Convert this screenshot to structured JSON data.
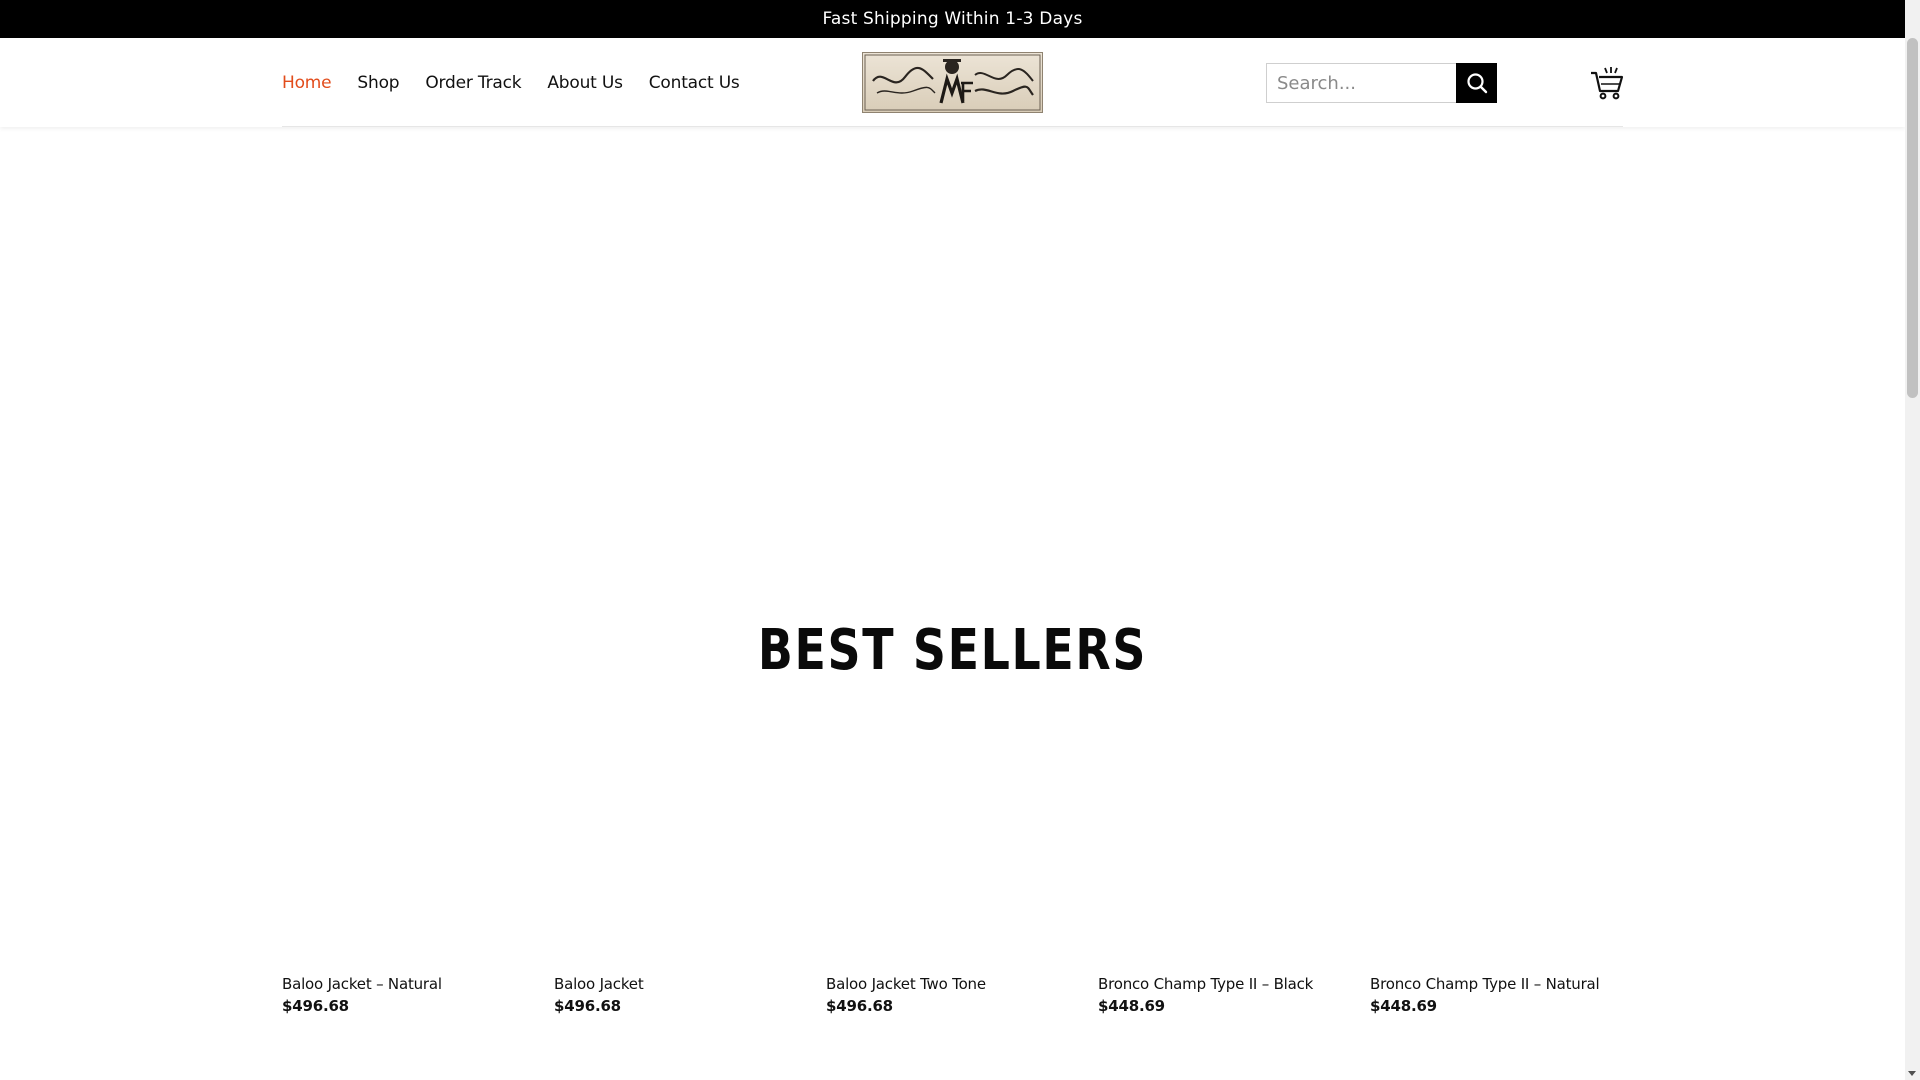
{
  "announcement": {
    "text": "Fast Shipping Within 1-3 Days"
  },
  "nav": {
    "items": [
      {
        "label": "Home",
        "active": true
      },
      {
        "label": "Shop",
        "active": false
      },
      {
        "label": "Order Track",
        "active": false
      },
      {
        "label": "About Us",
        "active": false
      },
      {
        "label": "Contact Us",
        "active": false
      }
    ]
  },
  "logo": {
    "icon": "brand-logo"
  },
  "search": {
    "placeholder": "Search...",
    "value": "",
    "icon": "search-icon"
  },
  "cart": {
    "icon": "cart-icon"
  },
  "colors": {
    "accent": "#e24c1b",
    "topbar": "#000000",
    "text": "#111111"
  },
  "best_sellers": {
    "title": "BEST SELLERS",
    "products": [
      {
        "name": "Baloo Jacket – Natural",
        "price": "$496.68"
      },
      {
        "name": "Baloo Jacket",
        "price": "$496.68"
      },
      {
        "name": "Baloo Jacket Two Tone",
        "price": "$496.68"
      },
      {
        "name": "Bronco Champ Type II – Black",
        "price": "$448.69"
      },
      {
        "name": "Bronco Champ Type II – Natural",
        "price": "$448.69"
      }
    ]
  }
}
